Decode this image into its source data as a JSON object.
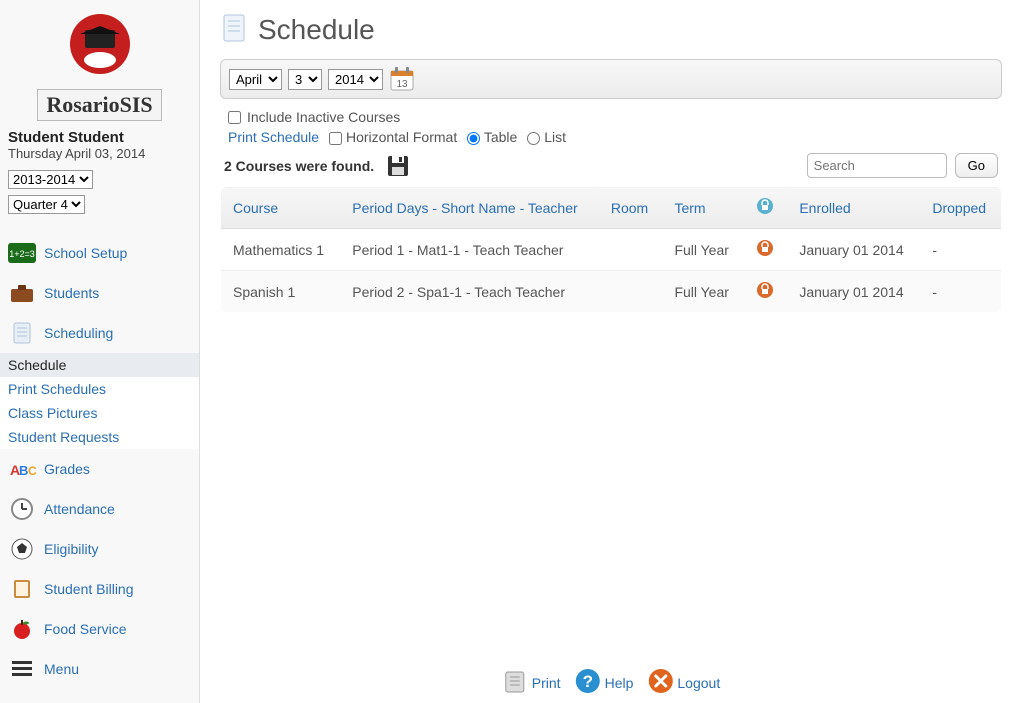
{
  "brand": "RosarioSIS",
  "student_name": "Student Student",
  "student_date": "Thursday April 03, 2014",
  "year_select": "2013-2014",
  "quarter_select": "Quarter 4",
  "nav": {
    "school_setup": "School Setup",
    "students": "Students",
    "scheduling": "Scheduling",
    "grades": "Grades",
    "attendance": "Attendance",
    "eligibility": "Eligibility",
    "student_billing": "Student Billing",
    "food_service": "Food Service",
    "menu": "Menu"
  },
  "subnav": {
    "schedule": "Schedule",
    "print_schedules": "Print Schedules",
    "class_pictures": "Class Pictures",
    "student_requests": "Student Requests"
  },
  "page_title": "Schedule",
  "date": {
    "month": "April",
    "day": "3",
    "year": "2014",
    "cal_day": "13"
  },
  "options": {
    "include_inactive": "Include Inactive Courses",
    "print_schedule": "Print Schedule",
    "horizontal_format": "Horizontal Format",
    "table": "Table",
    "list": "List"
  },
  "results_text": "2 Courses were found.",
  "search": {
    "placeholder": "Search",
    "go": "Go"
  },
  "columns": {
    "course": "Course",
    "period": "Period Days - Short Name - Teacher",
    "room": "Room",
    "term": "Term",
    "enrolled": "Enrolled",
    "dropped": "Dropped"
  },
  "rows": [
    {
      "course": "Mathematics 1",
      "period": "Period 1 - Mat1-1 - Teach Teacher",
      "room": "",
      "term": "Full Year",
      "enrolled": "January 01 2014",
      "dropped": "-"
    },
    {
      "course": "Spanish 1",
      "period": "Period 2 - Spa1-1 - Teach Teacher",
      "room": "",
      "term": "Full Year",
      "enrolled": "January 01 2014",
      "dropped": "-"
    }
  ],
  "footer": {
    "print": "Print",
    "help": "Help",
    "logout": "Logout"
  }
}
